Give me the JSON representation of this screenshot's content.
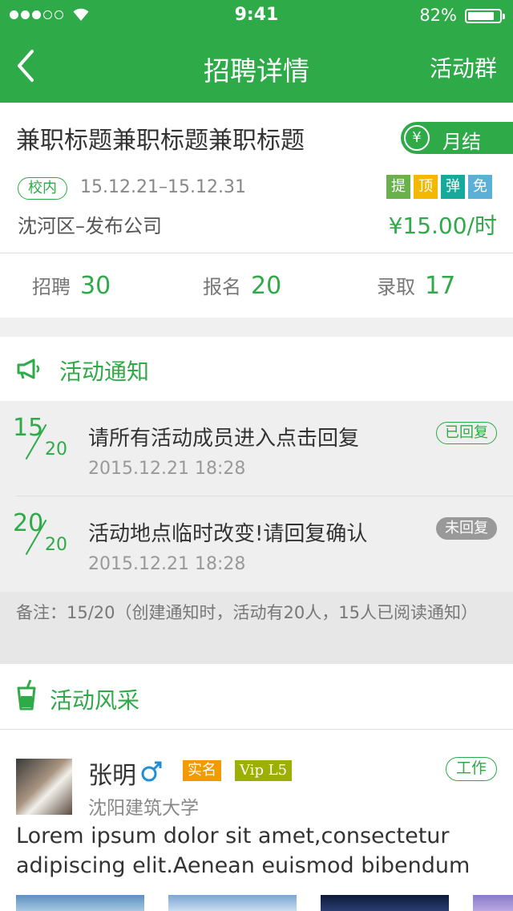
{
  "status_bar": {
    "time": "9:41",
    "battery": "82%"
  },
  "nav": {
    "title": "招聘详情",
    "right_action": "活动群"
  },
  "job": {
    "title": "兼职标题兼职标题兼职标题",
    "settlement": "月结",
    "yen_symbol": "¥",
    "campus_tag": "校内",
    "date_range": "15.12.21–15.12.31",
    "tags": [
      {
        "label": "提",
        "color": "#6ab04c"
      },
      {
        "label": "顶",
        "color": "#f5b800"
      },
      {
        "label": "弹",
        "color": "#17a999"
      },
      {
        "label": "免",
        "color": "#5bb0d8"
      }
    ],
    "location": "沈河区–发布公司",
    "salary": "¥15.00/时"
  },
  "stats": {
    "recruit_label": "招聘",
    "recruit_value": "30",
    "signup_label": "报名",
    "signup_value": "20",
    "hired_label": "录取",
    "hired_value": "17"
  },
  "notices": {
    "title": "活动通知",
    "items": [
      {
        "num": "15",
        "den": "20",
        "text": "请所有活动成员进入点击回复",
        "time": "2015.12.21   18:28",
        "status": "已回复"
      },
      {
        "num": "20",
        "den": "20",
        "text": "活动地点临时改变!请回复确认",
        "time": "2015.12.21   18:28",
        "status": "未回复"
      }
    ],
    "remark": "备注：15/20（创建通知时，活动有20人，15人已阅读通知）"
  },
  "gallery": {
    "title": "活动风采",
    "post": {
      "name": "张明",
      "gender": "♂",
      "badge_real": "实名",
      "badge_vip": "Vip L5",
      "work_tag": "工作",
      "school": "沈阳建筑大学",
      "text": "Lorem ipsum dolor sit amet,consectetur adipiscing elit.Aenean euismod bibendum"
    }
  },
  "colors": {
    "brand_green": "#2eaa48",
    "vip": "#9bb000",
    "real_name": "#f39a00",
    "gender": "#1e8fd6"
  }
}
